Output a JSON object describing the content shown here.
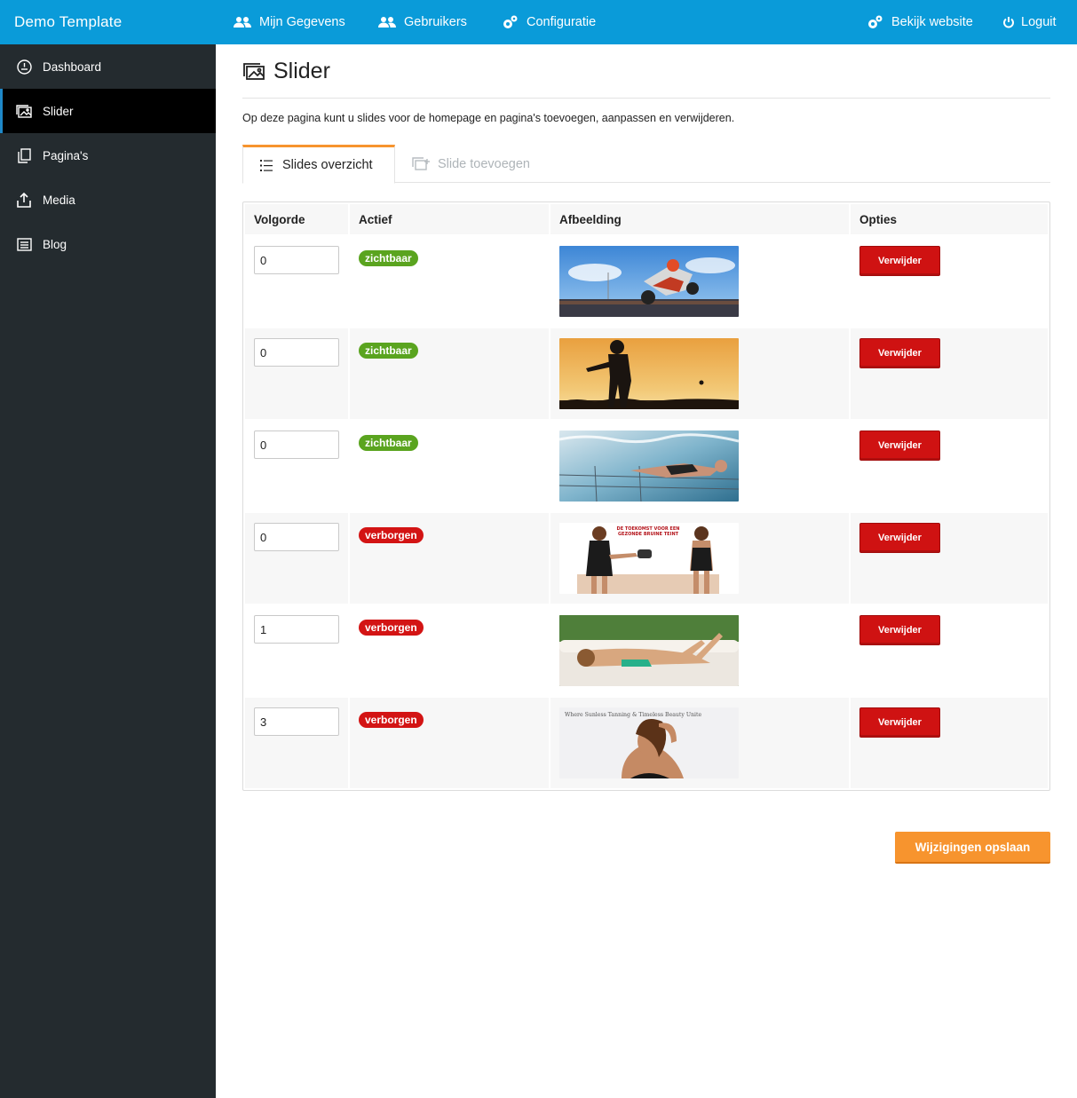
{
  "topbar": {
    "brand": "Demo Template",
    "nav": [
      {
        "label": "Mijn Gegevens",
        "icon": "users-icon"
      },
      {
        "label": "Gebruikers",
        "icon": "users-icon"
      },
      {
        "label": "Configuratie",
        "icon": "gears-icon"
      }
    ],
    "right": [
      {
        "label": "Bekijk website",
        "icon": "gears-icon"
      },
      {
        "label": "Loguit",
        "icon": "power-icon"
      }
    ],
    "color": "#0a9bd9"
  },
  "sidebar": {
    "items": [
      {
        "label": "Dashboard",
        "icon": "dashboard-icon"
      },
      {
        "label": "Slider",
        "icon": "slider-icon",
        "active": true
      },
      {
        "label": "Pagina's",
        "icon": "pages-icon"
      },
      {
        "label": "Media",
        "icon": "upload-icon"
      },
      {
        "label": "Blog",
        "icon": "blog-icon"
      }
    ]
  },
  "page": {
    "title": "Slider",
    "description": "Op deze pagina kunt u slides voor de homepage en pagina's toevoegen, aanpassen en verwijderen."
  },
  "tabs": [
    {
      "label": "Slides overzicht",
      "active": true,
      "icon": "list-icon"
    },
    {
      "label": "Slide toevoegen",
      "active": false,
      "icon": "add-slide-icon"
    }
  ],
  "table": {
    "headers": [
      "Volgorde",
      "Actief",
      "Afbeelding",
      "Opties"
    ],
    "rows": [
      {
        "order": "0",
        "status": "zichtbaar",
        "image": "motocross rider photo"
      },
      {
        "order": "0",
        "status": "zichtbaar",
        "image": "cricket silhouette sunset photo"
      },
      {
        "order": "0",
        "status": "zichtbaar",
        "image": "swimmer underwater photo"
      },
      {
        "order": "0",
        "status": "verborgen",
        "image": "tanning banner photo"
      },
      {
        "order": "1",
        "status": "verborgen",
        "image": "woman on sofa photo"
      },
      {
        "order": "3",
        "status": "verborgen",
        "image": "sunless tanning banner photo"
      }
    ],
    "delete_label": "Verwijder"
  },
  "banner_texts": {
    "row4_line1": "DE TOEKOMST VOOR EEN",
    "row4_line2": "GEZONDE BRUINE TEINT",
    "row6": "Where Sunless Tanning & Timeless Beauty Unite"
  },
  "save_label": "Wijzigingen opslaan",
  "colors": {
    "accent": "#f7942e",
    "danger": "#cf1212",
    "success": "#5aa41f",
    "sidebar": "#242b2f"
  }
}
